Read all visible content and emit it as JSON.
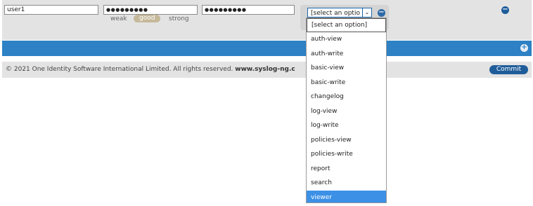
{
  "form": {
    "username": "user1",
    "password": "●●●●●●●●●",
    "password_confirm": "●●●●●●●●●",
    "strength": {
      "weak": "weak",
      "good": "good",
      "strong": "strong"
    },
    "role_select_value": "[select an optio"
  },
  "footer": {
    "copyright": "© 2021 One Identity Software International Limited. All rights reserved.",
    "site": "www.syslog-ng.c",
    "commit_label": "Commit"
  },
  "dropdown": {
    "options": [
      "[select an option]",
      "auth-view",
      "auth-write",
      "basic-view",
      "basic-write",
      "changelog",
      "log-view",
      "log-write",
      "policies-view",
      "policies-write",
      "report",
      "search",
      "viewer"
    ],
    "highlighted": "viewer"
  },
  "icons": {
    "remove": "minus-circle-icon",
    "add": "plus-circle-icon",
    "chevron": "chevron-down-icon"
  },
  "colors": {
    "accent": "#2d81c4",
    "commit_bg": "#1f5d9a",
    "highlight": "#3c91e6",
    "strength_good": "#c5b99a"
  }
}
